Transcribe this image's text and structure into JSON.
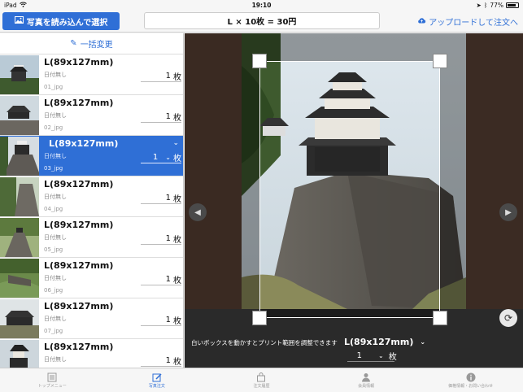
{
  "status": {
    "carrier": "iPad",
    "time": "19:10",
    "battery": "77%"
  },
  "topbar": {
    "select_button": "写真を読み込んで選択",
    "price": "L × 10枚 = 30円",
    "upload": "アップロードして注文へ"
  },
  "list": {
    "bulk_edit": "一括変更",
    "unit": "枚",
    "items": [
      {
        "size": "L(89x127mm)",
        "date": "日付無し",
        "file": "01_jpg",
        "qty": "1",
        "selected": false
      },
      {
        "size": "L(89x127mm)",
        "date": "日付無し",
        "file": "02_jpg",
        "qty": "1",
        "selected": false
      },
      {
        "size": "L(89x127mm)",
        "date": "日付無し",
        "file": "03_jpg",
        "qty": "1",
        "selected": true
      },
      {
        "size": "L(89x127mm)",
        "date": "日付無し",
        "file": "04_jpg",
        "qty": "1",
        "selected": false
      },
      {
        "size": "L(89x127mm)",
        "date": "日付無し",
        "file": "05_jpg",
        "qty": "1",
        "selected": false
      },
      {
        "size": "L(89x127mm)",
        "date": "日付無し",
        "file": "06_jpg",
        "qty": "1",
        "selected": false
      },
      {
        "size": "L(89x127mm)",
        "date": "日付無し",
        "file": "07_jpg",
        "qty": "1",
        "selected": false
      },
      {
        "size": "L(89x127mm)",
        "date": "日付無し",
        "file": "08_jpg",
        "qty": "1",
        "selected": false
      }
    ]
  },
  "editor": {
    "note": "白いボックスを動かすとプリント範囲を調整できます",
    "size": "L(89x127mm)",
    "qty": "1",
    "unit": "枚"
  },
  "tabs": [
    {
      "label": "トップメニュー",
      "icon": "menu-icon",
      "active": false
    },
    {
      "label": "写真注文",
      "icon": "photo-order-icon",
      "active": true
    },
    {
      "label": "注文履歴",
      "icon": "bag-icon",
      "active": false
    },
    {
      "label": "会員情報",
      "icon": "person-icon",
      "active": false
    },
    {
      "label": "価格情報・お問い合わせ",
      "icon": "info-icon",
      "active": false
    }
  ],
  "colors": {
    "accent": "#2f6fd6",
    "editor_bg": "#2a2a2a"
  }
}
